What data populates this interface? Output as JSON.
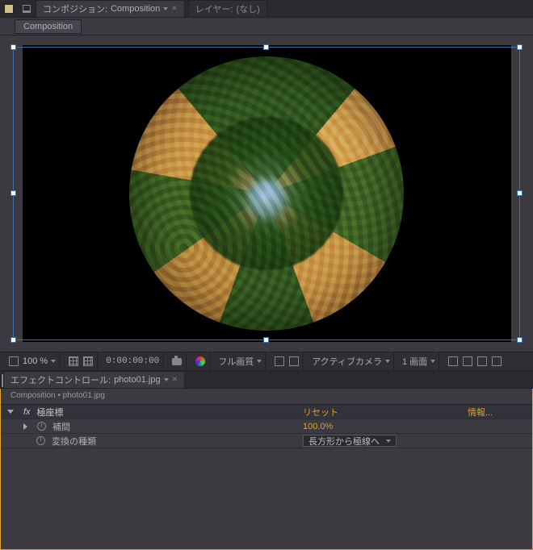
{
  "tabs": {
    "composition_prefix": "コンポジション:",
    "composition_name": "Composition",
    "layer_prefix": "レイヤー:",
    "layer_name": "(なし)"
  },
  "breadcrumb": "Composition",
  "status": {
    "zoom": "100 %",
    "timecode": "0:00:00:00",
    "quality": "フル画質",
    "camera": "アクティブカメラ",
    "views": "1 画面"
  },
  "effects": {
    "tab_prefix": "エフェクトコントロール:",
    "tab_file": "photo01.jpg",
    "path_comp": "Composition",
    "path_sep": " • ",
    "path_file": "photo01.jpg",
    "fx_badge": "fx",
    "effect_name": "極座標",
    "reset": "リセット",
    "info": "情報...",
    "rows": {
      "interp_label": "補間",
      "interp_value": "100.0%",
      "type_label": "変換の種類",
      "type_value": "長方形から極線へ"
    }
  }
}
